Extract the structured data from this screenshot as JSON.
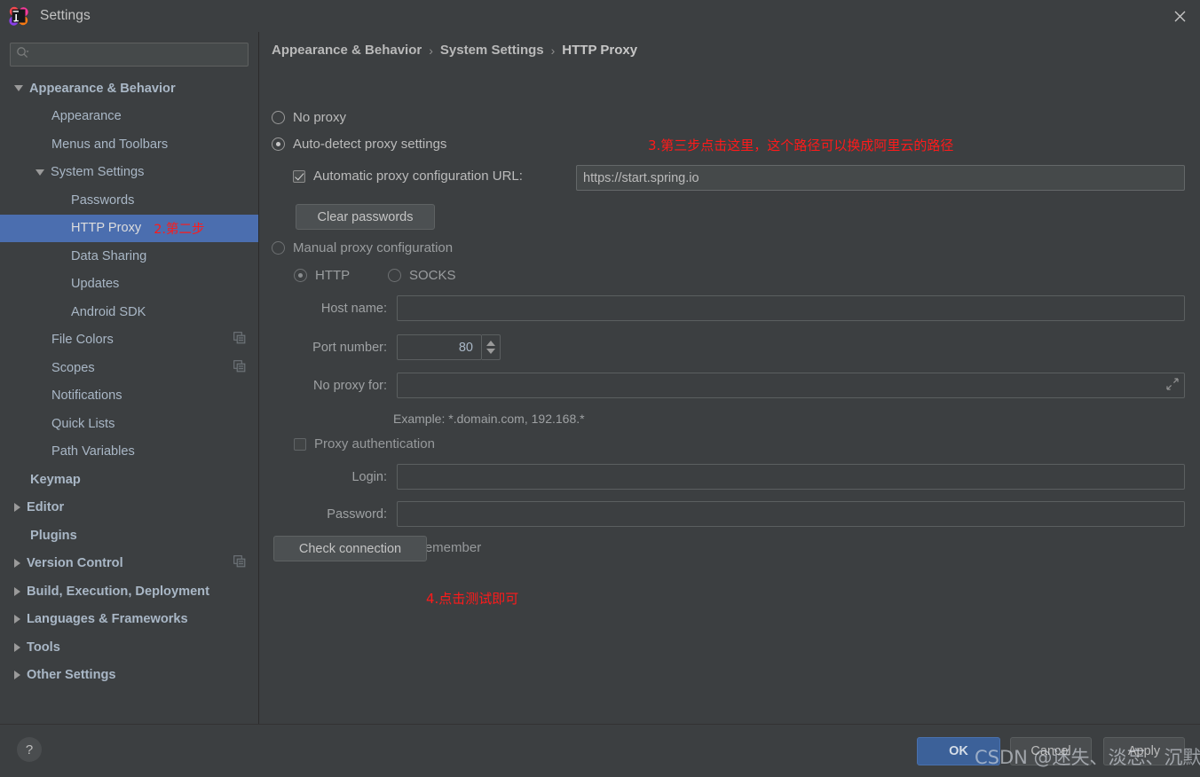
{
  "window": {
    "title": "Settings",
    "app_icon": "intellij-idea-icon",
    "close_icon": "close-icon"
  },
  "search": {
    "value": "",
    "placeholder": "",
    "icon": "search-icon"
  },
  "sidebar": {
    "items": [
      {
        "label": "Appearance & Behavior",
        "indent": 0,
        "arrow": "down",
        "bold": true,
        "selected": false,
        "copy_icon": false
      },
      {
        "label": "Appearance",
        "indent": 1,
        "arrow": "none",
        "bold": false,
        "selected": false,
        "copy_icon": false
      },
      {
        "label": "Menus and Toolbars",
        "indent": 1,
        "arrow": "none",
        "bold": false,
        "selected": false,
        "copy_icon": false
      },
      {
        "label": "System Settings",
        "indent": 1,
        "arrow": "down",
        "bold": false,
        "selected": false,
        "copy_icon": false
      },
      {
        "label": "Passwords",
        "indent": 2,
        "arrow": "none",
        "bold": false,
        "selected": false,
        "copy_icon": false
      },
      {
        "label": "HTTP Proxy",
        "indent": 2,
        "arrow": "none",
        "bold": false,
        "selected": true,
        "copy_icon": false,
        "annotation": "2.第二步"
      },
      {
        "label": "Data Sharing",
        "indent": 2,
        "arrow": "none",
        "bold": false,
        "selected": false,
        "copy_icon": false
      },
      {
        "label": "Updates",
        "indent": 2,
        "arrow": "none",
        "bold": false,
        "selected": false,
        "copy_icon": false
      },
      {
        "label": "Android SDK",
        "indent": 2,
        "arrow": "none",
        "bold": false,
        "selected": false,
        "copy_icon": false
      },
      {
        "label": "File Colors",
        "indent": 1,
        "arrow": "none",
        "bold": false,
        "selected": false,
        "copy_icon": true
      },
      {
        "label": "Scopes",
        "indent": 1,
        "arrow": "none",
        "bold": false,
        "selected": false,
        "copy_icon": true
      },
      {
        "label": "Notifications",
        "indent": 1,
        "arrow": "none",
        "bold": false,
        "selected": false,
        "copy_icon": false
      },
      {
        "label": "Quick Lists",
        "indent": 1,
        "arrow": "none",
        "bold": false,
        "selected": false,
        "copy_icon": false
      },
      {
        "label": "Path Variables",
        "indent": 1,
        "arrow": "none",
        "bold": false,
        "selected": false,
        "copy_icon": false
      },
      {
        "label": "Keymap",
        "indent": 0,
        "arrow": "none",
        "bold": true,
        "selected": false,
        "copy_icon": false
      },
      {
        "label": "Editor",
        "indent": 0,
        "arrow": "right",
        "bold": true,
        "selected": false,
        "copy_icon": false
      },
      {
        "label": "Plugins",
        "indent": 0,
        "arrow": "none",
        "bold": true,
        "selected": false,
        "copy_icon": false
      },
      {
        "label": "Version Control",
        "indent": 0,
        "arrow": "right",
        "bold": true,
        "selected": false,
        "copy_icon": true
      },
      {
        "label": "Build, Execution, Deployment",
        "indent": 0,
        "arrow": "right",
        "bold": true,
        "selected": false,
        "copy_icon": false
      },
      {
        "label": "Languages & Frameworks",
        "indent": 0,
        "arrow": "right",
        "bold": true,
        "selected": false,
        "copy_icon": false
      },
      {
        "label": "Tools",
        "indent": 0,
        "arrow": "right",
        "bold": true,
        "selected": false,
        "copy_icon": false
      },
      {
        "label": "Other Settings",
        "indent": 0,
        "arrow": "right",
        "bold": true,
        "selected": false,
        "copy_icon": false
      }
    ]
  },
  "breadcrumb": {
    "crumb1": "Appearance & Behavior",
    "sep": "›",
    "crumb2": "System Settings",
    "crumb3": "HTTP Proxy"
  },
  "proxy": {
    "no_proxy_label": "No proxy",
    "auto_detect_label": "Auto-detect proxy settings",
    "auto_config_label": "Automatic proxy configuration URL:",
    "auto_config_url": "https://start.spring.io",
    "clear_passwords_label": "Clear passwords",
    "manual_label": "Manual proxy configuration",
    "http_label": "HTTP",
    "socks_label": "SOCKS",
    "host_label": "Host name:",
    "host_value": "",
    "port_label": "Port number:",
    "port_value": "80",
    "no_proxy_for_label": "No proxy for:",
    "no_proxy_for_value": "",
    "example_hint": "Example: *.domain.com, 192.168.*",
    "proxy_auth_label": "Proxy authentication",
    "login_label": "Login:",
    "login_value": "",
    "password_label": "Password:",
    "password_value": "",
    "remember_label": "Remember",
    "check_connection_label": "Check connection",
    "expand_icon": "expand-icon"
  },
  "annotations": {
    "step3": "3.第三步点击这里，这个路径可以换成阿里云的路径",
    "step4": "4.点击测试即可",
    "color": "#FF1A1A"
  },
  "footer": {
    "help_label": "?",
    "ok_label": "OK",
    "cancel_label": "Cancel",
    "apply_label": "Apply",
    "watermark": "CSDN @迷失、淡忘、沉默"
  },
  "colors": {
    "background": "#3C3F41",
    "selection": "#4B6EAF",
    "accent": "#3C6199",
    "annotation_red": "#FF1A1A"
  }
}
